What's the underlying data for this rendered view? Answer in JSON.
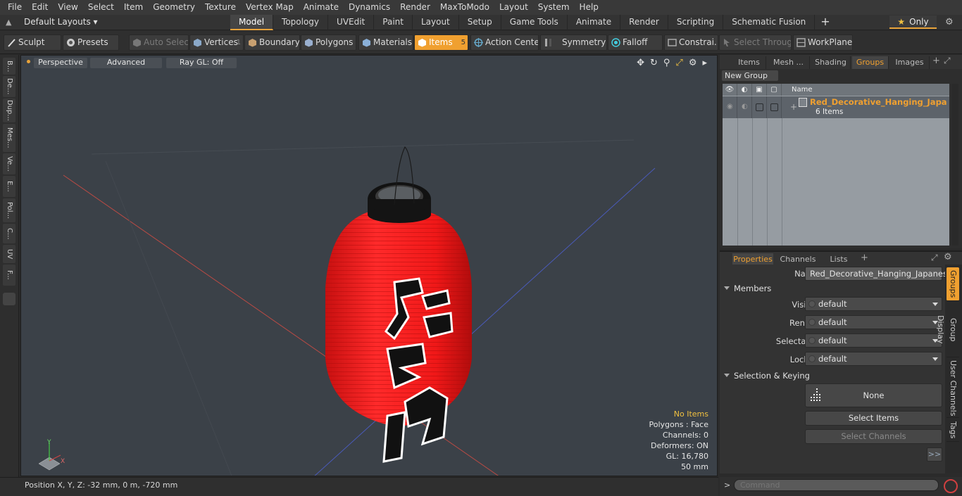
{
  "menu": [
    "File",
    "Edit",
    "View",
    "Select",
    "Item",
    "Geometry",
    "Texture",
    "Vertex Map",
    "Animate",
    "Dynamics",
    "Render",
    "MaxToModo",
    "Layout",
    "System",
    "Help"
  ],
  "layout": {
    "selector": "Default Layouts ▾",
    "tabs": [
      "Model",
      "Topology",
      "UVEdit",
      "Paint",
      "Layout",
      "Setup",
      "Game Tools",
      "Animate",
      "Render",
      "Scripting",
      "Schematic Fusion"
    ],
    "active_tab": "Model",
    "only_label": "Only"
  },
  "toolbar": {
    "sculpt": "Sculpt",
    "presets": "Presets",
    "auto_select": "Auto Select",
    "vertices": "Vertices",
    "vertices_count": "1",
    "boundary": "Boundary",
    "polygons": "Polygons",
    "materials": "Materials",
    "items": "Items",
    "items_count": "5",
    "action_center": "Action Center",
    "symmetry": "Symmetry",
    "falloff": "Falloff",
    "constraints": "Constrai...",
    "select_through": "Select Through",
    "workplane": "WorkPlane"
  },
  "left_strip": [
    "B...",
    "De...",
    "Dup...",
    "Mes...",
    "Ve...",
    "E...",
    "Pol...",
    "C...",
    "UV",
    "F..."
  ],
  "viewport": {
    "view": "Perspective",
    "shading": "Advanced",
    "raygl": "Ray GL: Off",
    "stats": {
      "selection": "No Items",
      "polygons": "Polygons : Face",
      "channels": "Channels: 0",
      "deformers": "Deformers: ON",
      "gl": "GL: 16,780",
      "scale": "50 mm"
    },
    "axis_y": "Y",
    "axis_x": "X"
  },
  "status": {
    "position": "Position X, Y, Z:   -32 mm, 0 m, -720 mm"
  },
  "right_tabs": [
    "Items",
    "Mesh ...",
    "Shading",
    "Groups",
    "Images"
  ],
  "groups": {
    "new_group": "New Group",
    "name_col": "Name",
    "item_name": "Red_Decorative_Hanging_Japa ...",
    "item_sub": "6 Items"
  },
  "prop_tabs": [
    "Properties",
    "Channels",
    "Lists"
  ],
  "properties": {
    "name_label": "Name",
    "name_value": "Red_Decorative_Hanging_Japanese_l",
    "members": "Members",
    "visible_label": "Visible",
    "render_label": "Render",
    "selectable_label": "Selectable",
    "locked_label": "Locked",
    "default": "default",
    "sel_keying": "Selection & Keying",
    "none": "None",
    "select_items": "Select Items",
    "select_channels": "Select Channels",
    "more": ">>"
  },
  "vertical_tabs": [
    "Groups",
    "Group Display",
    "User Channels",
    "Tags"
  ],
  "command": {
    "placeholder": "Command"
  },
  "colors": {
    "accent": "#f0a030",
    "lantern": "#e82020"
  }
}
